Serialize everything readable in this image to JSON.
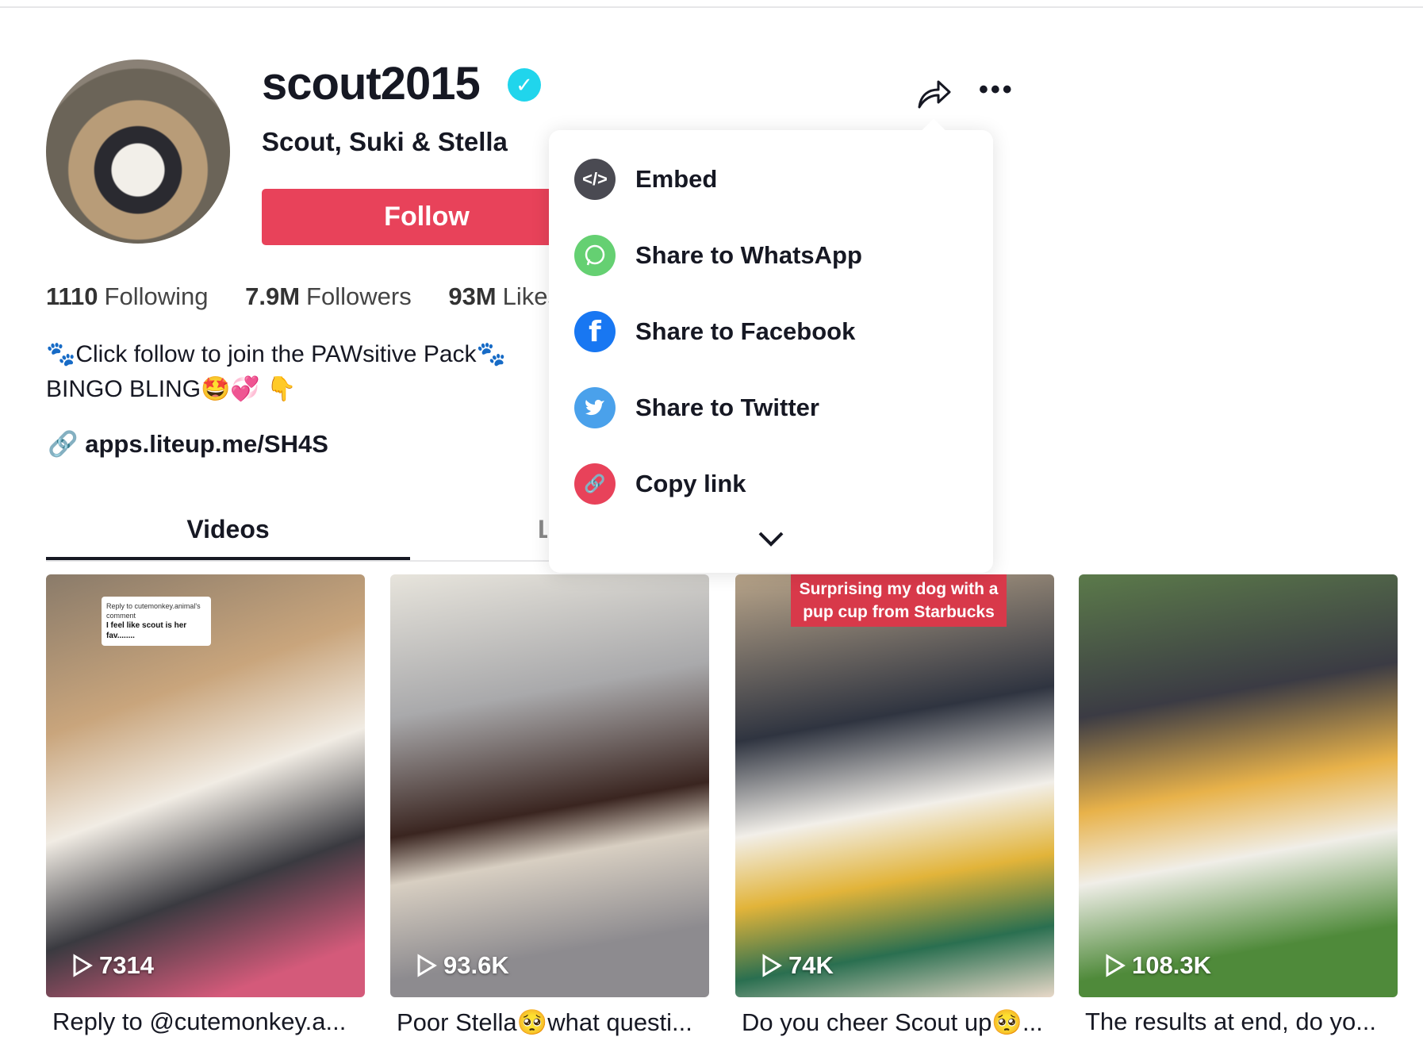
{
  "profile": {
    "username": "scout2015",
    "nickname": "Scout, Suki & Stella",
    "follow_label": "Follow",
    "stats": [
      {
        "value": "1110",
        "label": "Following"
      },
      {
        "value": "7.9M",
        "label": "Followers"
      },
      {
        "value": "93M",
        "label": "Likes"
      }
    ],
    "bio_line1": "🐾Click follow to join the PAWsitive Pack🐾",
    "bio_line2": "BINGO BLING🤩💞 👇",
    "link": "apps.liteup.me/SH4S"
  },
  "tabs": [
    {
      "label": "Videos",
      "active": true
    },
    {
      "label": "Liked",
      "active": false
    }
  ],
  "share_menu": {
    "items": [
      {
        "label": "Embed",
        "icon": "code-icon",
        "color": "#4a4a52"
      },
      {
        "label": "Share to WhatsApp",
        "icon": "whatsapp-icon",
        "color": "#65d072"
      },
      {
        "label": "Share to Facebook",
        "icon": "facebook-icon",
        "color": "#1877f2"
      },
      {
        "label": "Share to Twitter",
        "icon": "twitter-icon",
        "color": "#4aa1eb"
      },
      {
        "label": "Copy link",
        "icon": "link-icon",
        "color": "#e8425a"
      }
    ]
  },
  "videos": [
    {
      "views": "7314",
      "caption": "Reply to @cutemonkey.a...",
      "bubble_header": "Reply to cutemonkey.animal's comment",
      "bubble_text": "I feel like scout is her fav........"
    },
    {
      "views": "93.6K",
      "caption": "Poor Stella🥺what questi..."
    },
    {
      "views": "74K",
      "caption": "Do you cheer Scout up🥺...",
      "overlay": "Surprising my dog with a pup cup from Starbucks"
    },
    {
      "views": "108.3K",
      "caption": "The results at end, do yo..."
    }
  ],
  "colors": {
    "accent": "#e8425a",
    "verified": "#20d5ec"
  }
}
